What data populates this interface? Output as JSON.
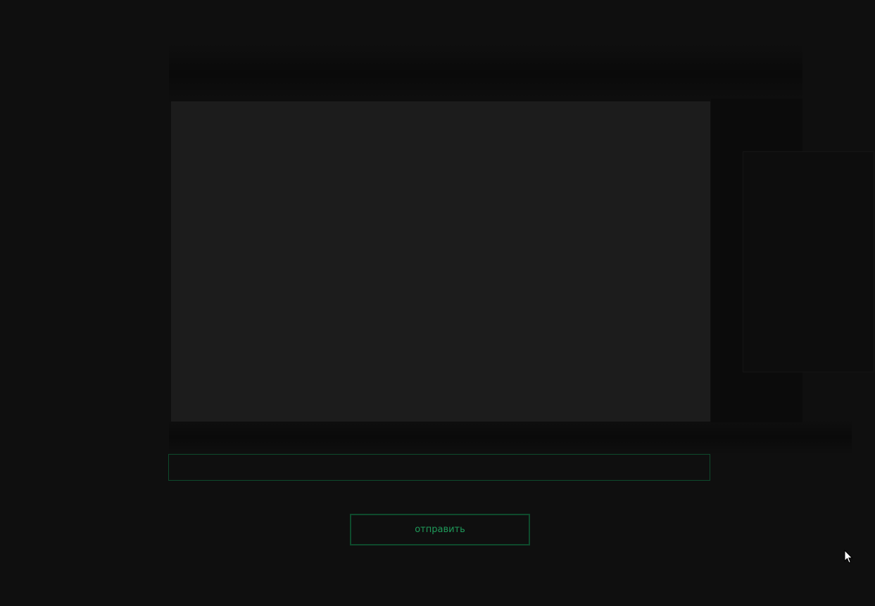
{
  "chat": {
    "display_text": ""
  },
  "input": {
    "value": "",
    "placeholder": ""
  },
  "send_button": {
    "label": "отправить"
  },
  "colors": {
    "background": "#0f0f0f",
    "panel": "#1c1c1c",
    "accent_border": "#0e4a2c",
    "accent_text": "#1f9a5a"
  },
  "icons": {
    "cursor": "mouse-pointer-icon"
  }
}
